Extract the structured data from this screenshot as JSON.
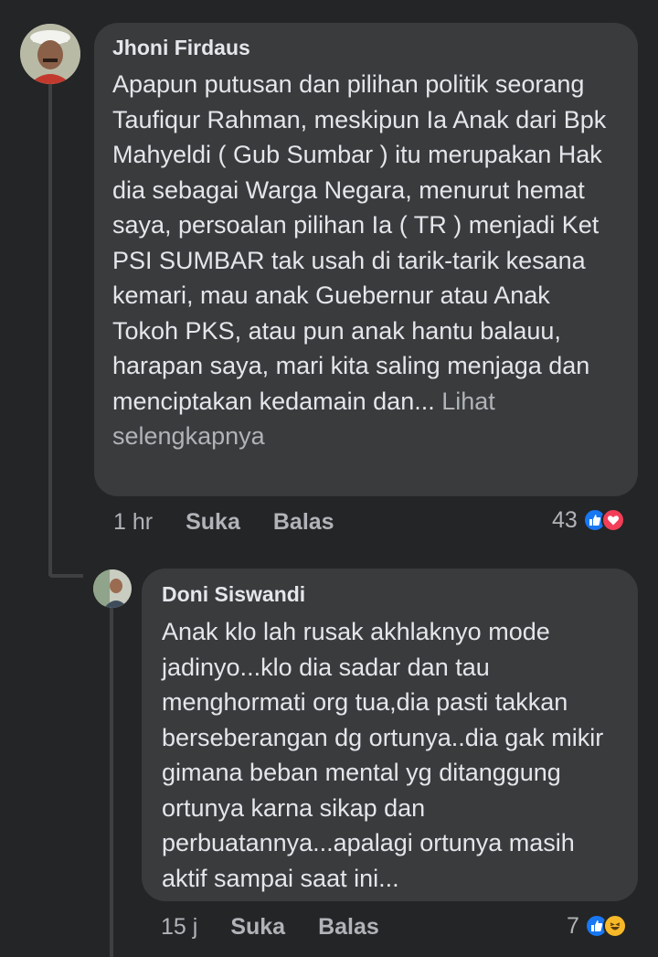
{
  "comment": {
    "author": "Jhoni Firdaus",
    "text": "Apapun putusan dan pilihan politik seorang Taufiqur Rahman, meskipun Ia Anak dari Bpk Mahyeldi ( Gub Sumbar ) itu merupakan Hak dia sebagai Warga Negara, menurut hemat saya, persoalan pilihan Ia ( TR ) menjadi Ket PSI SUMBAR tak usah di tarik-tarik kesana kemari, mau anak Guebernur atau Anak Tokoh PKS, atau pun anak hantu balauu, harapan saya, mari kita saling menjaga dan menciptakan kedamain dan...",
    "see_more": "Lihat selengkapnya",
    "time": "1 hr",
    "like_label": "Suka",
    "reply_label": "Balas",
    "reaction_count": "43",
    "reaction_icons": [
      "like-icon",
      "love-icon"
    ],
    "colors": {
      "like": "#1877f2",
      "love": "#f33e58"
    }
  },
  "reply": {
    "author": "Doni Siswandi",
    "text": "Anak klo lah rusak akhlaknyo mode jadinyo...klo dia sadar dan tau menghormati org tua,dia pasti takkan berseberangan dg ortunya..dia gak mikir gimana beban mental yg ditanggung ortunya karna sikap dan perbuatannya...apalagi ortunya masih aktif sampai saat ini...",
    "time": "15 j",
    "like_label": "Suka",
    "reply_label": "Balas",
    "reaction_count": "7",
    "reaction_icons": [
      "like-icon",
      "haha-icon"
    ],
    "colors": {
      "like": "#1877f2",
      "haha": "#f7b928"
    }
  }
}
